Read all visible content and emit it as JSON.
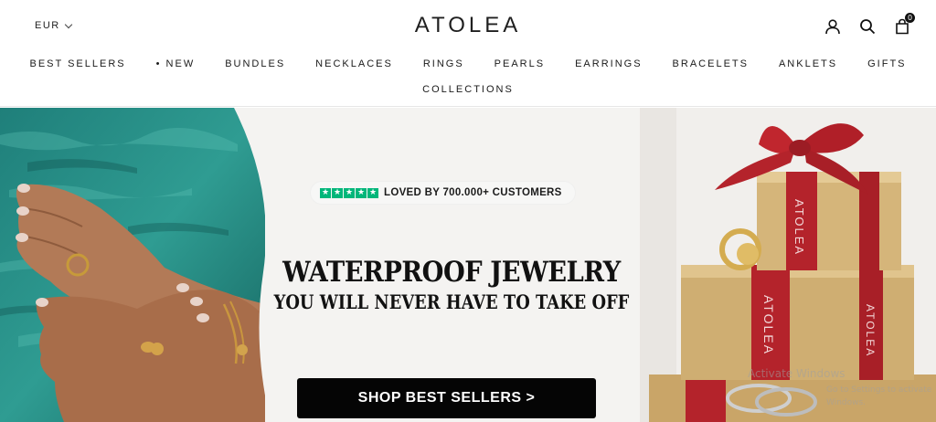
{
  "header": {
    "currency": "EUR",
    "logo": "ATOLEA",
    "cart_count": "0",
    "icons": [
      "account-icon",
      "search-icon",
      "cart-icon"
    ]
  },
  "nav": {
    "row1": [
      "BEST SELLERS",
      "• NEW",
      "BUNDLES",
      "NECKLACES",
      "RINGS",
      "PEARLS",
      "EARRINGS",
      "BRACELETS",
      "ANKLETS",
      "GIFTS"
    ],
    "row2": [
      "COLLECTIONS"
    ]
  },
  "hero": {
    "badge_text": "LOVED BY 700.000+ CUSTOMERS",
    "star_color": "#00b67a",
    "headline": "WATERPROOF JEWELRY",
    "subline": "YOU WILL NEVER HAVE TO TAKE OFF",
    "cta_label": "SHOP BEST SELLERS >",
    "gift_ribbon_text": "ATOLEA"
  },
  "system": {
    "watermark_line1": "Activate Windows",
    "watermark_line2": "Go to Settings to activate Windows."
  }
}
